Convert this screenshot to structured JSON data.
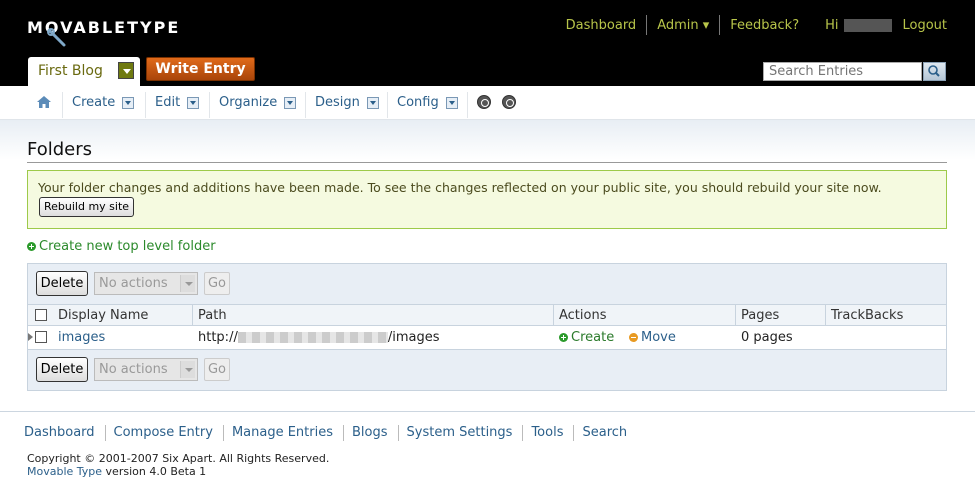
{
  "app": {
    "logo_text": "MOVABLETYPE"
  },
  "header": {
    "nav": {
      "dashboard": "Dashboard",
      "admin": "Admin ▾",
      "feedback": "Feedback?",
      "greeting": "Hi",
      "logout": "Logout"
    },
    "blog_name": "First Blog",
    "write_entry": "Write Entry",
    "search_placeholder": "Search Entries"
  },
  "menu": {
    "items": [
      "Create",
      "Edit",
      "Organize",
      "Design",
      "Config"
    ]
  },
  "page": {
    "title": "Folders",
    "message": "Your folder changes and additions have been made. To see the changes reflected on your public site, you should rebuild your site now.",
    "rebuild_button": "Rebuild my site",
    "create_folder": "Create new top level folder"
  },
  "list": {
    "delete_label": "Delete",
    "actions_placeholder": "No actions",
    "go_label": "Go",
    "columns": [
      "Display Name",
      "Path",
      "Actions",
      "Pages",
      "TrackBacks"
    ],
    "rows": [
      {
        "display_name": "images",
        "path_prefix": "http://",
        "path_suffix": "/images",
        "action_create": "Create",
        "action_move": "Move",
        "pages": "0 pages",
        "trackbacks": ""
      }
    ]
  },
  "footer": {
    "links": [
      "Dashboard",
      "Compose Entry",
      "Manage Entries",
      "Blogs",
      "System Settings",
      "Tools",
      "Search"
    ],
    "copyright": "Copyright © 2001-2007 Six Apart. All Rights Reserved.",
    "product_link": "Movable Type",
    "version": " version 4.0 Beta 1"
  },
  "colors": {
    "header_bg": "#000000",
    "nav_link": "#b8c54a",
    "link": "#2b5f8a",
    "write_entry": "#c8560f",
    "message_bg": "#f5fae0",
    "message_border": "#9dca4a"
  }
}
